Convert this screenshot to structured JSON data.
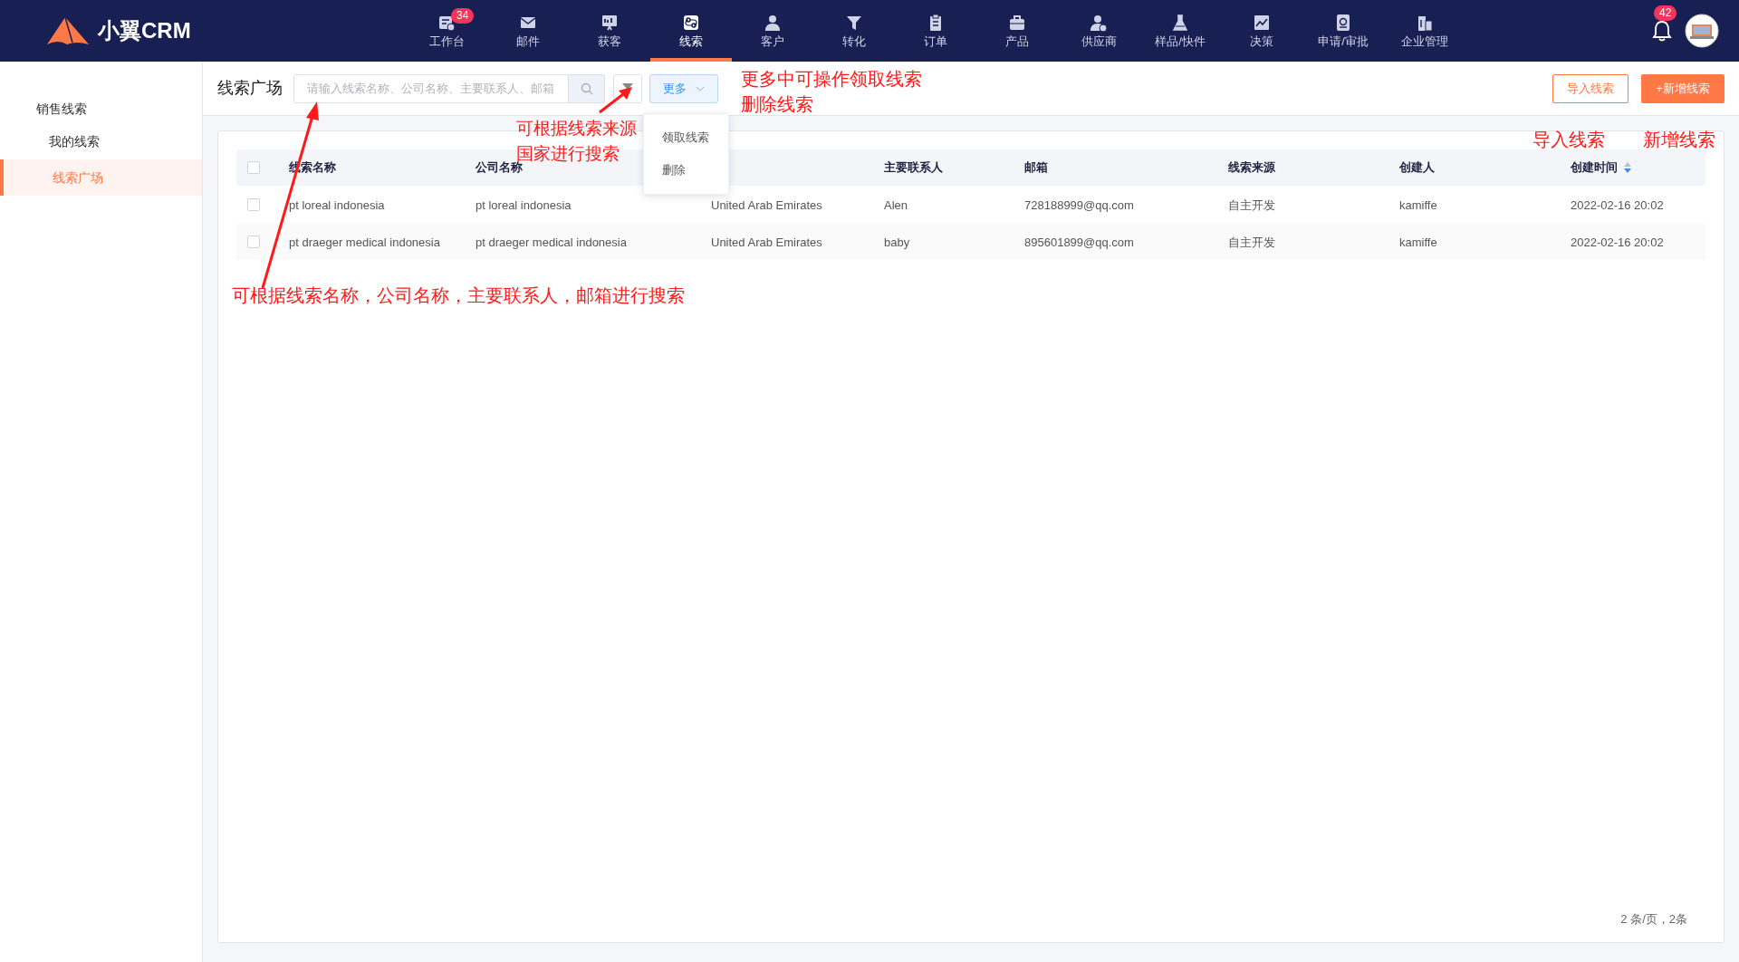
{
  "header": {
    "logo": "小翼CRM",
    "nav": [
      {
        "label": "工作台",
        "selected": false,
        "badge": "34"
      },
      {
        "label": "邮件",
        "selected": false
      },
      {
        "label": "获客",
        "selected": false
      },
      {
        "label": "线索",
        "selected": true
      },
      {
        "label": "客户",
        "selected": false
      },
      {
        "label": "转化",
        "selected": false
      },
      {
        "label": "订单",
        "selected": false
      },
      {
        "label": "产品",
        "selected": false
      },
      {
        "label": "供应商",
        "selected": false
      },
      {
        "label": "样品/快件",
        "selected": false
      },
      {
        "label": "决策",
        "selected": false
      },
      {
        "label": "申请/审批",
        "selected": false
      },
      {
        "label": "企业管理",
        "selected": false
      }
    ],
    "notifications": "42"
  },
  "sidebar": {
    "group": "销售线索",
    "items": [
      {
        "label": "我的线索",
        "selected": false
      },
      {
        "label": "线索广场",
        "selected": true
      }
    ]
  },
  "toolbar": {
    "title": "线索广场",
    "search": {
      "placeholder": "请输入线索名称、公司名称、主要联系人、邮箱"
    },
    "more": "更多",
    "more_menu": [
      "领取线索",
      "删除"
    ],
    "import": "导入线索",
    "add": "+新增线索"
  },
  "table": {
    "header_checked": false,
    "columns": [
      {
        "label": "线索名称"
      },
      {
        "label": "公司名称"
      },
      {},
      {
        "label": "主要联系人"
      },
      {
        "label": "邮箱"
      },
      {
        "label": "线索来源"
      },
      {
        "label": "创建人"
      },
      {
        "label": "创建时间",
        "sortable": true
      }
    ],
    "rows": [
      {
        "checked": false,
        "cells": [
          "pt loreal indonesia",
          "pt loreal indonesia",
          "United Arab Emirates",
          "Alen",
          "728188999@qq.com",
          "自主开发",
          "kamiffe",
          "2022-02-16 20:02"
        ]
      },
      {
        "checked": false,
        "cells": [
          "pt draeger medical indonesia",
          "pt draeger medical indonesia",
          "United Arab Emirates",
          "baby",
          "895601899@qq.com",
          "自主开发",
          "kamiffe",
          "2022-02-16 20:02"
        ]
      }
    ]
  },
  "pagination": "2 条/页，2条",
  "annotations": [
    {
      "lines": [
        "更多中可操作领取线索",
        "删除线索"
      ]
    },
    {
      "lines": [
        "可根据线索来源",
        "国家进行搜索"
      ]
    },
    {
      "lines": [
        "导入线索"
      ]
    },
    {
      "lines": [
        "新增线索"
      ]
    },
    {
      "lines": [
        "可根据线索名称，公司名称，主要联系人，邮箱进行搜索"
      ]
    }
  ]
}
